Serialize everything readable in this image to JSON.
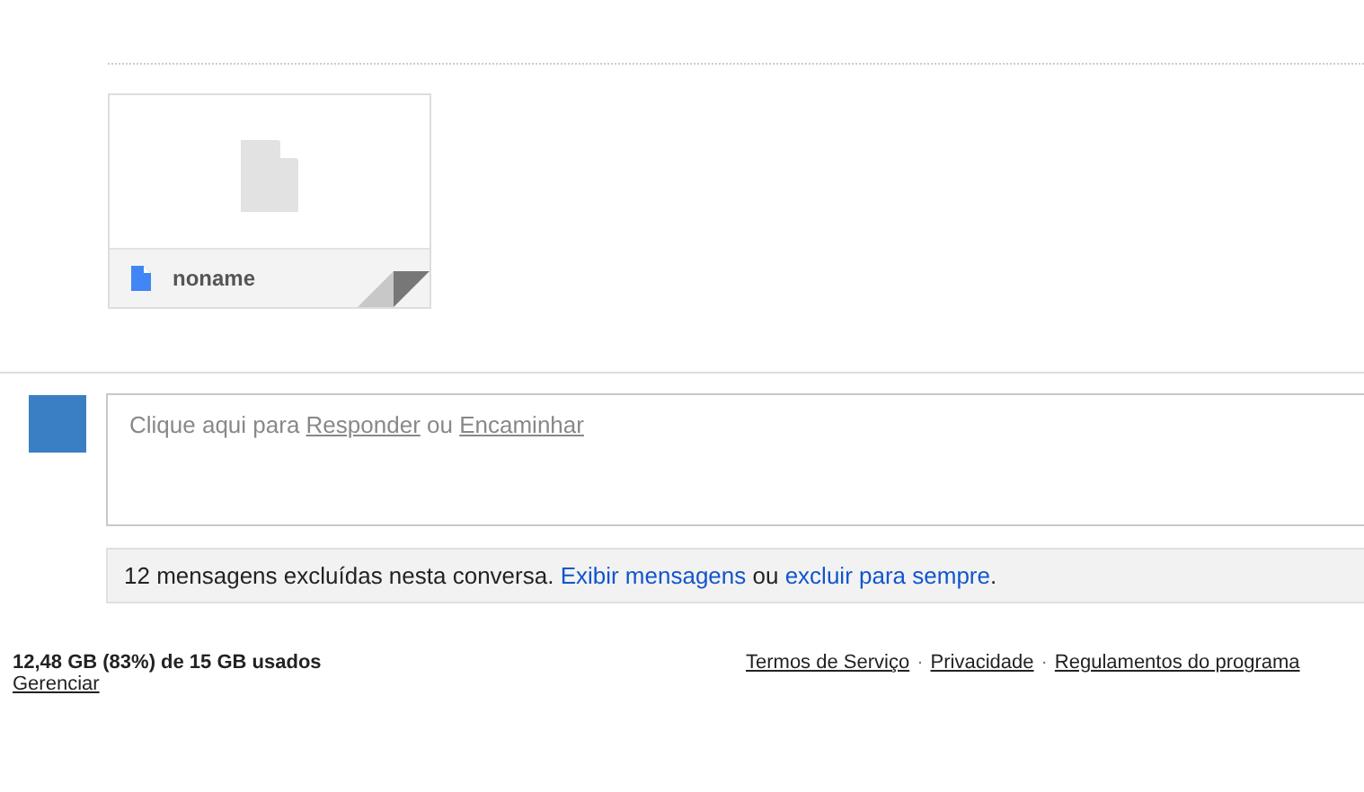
{
  "attachment": {
    "filename": "noname"
  },
  "reply_box": {
    "prefix": "Clique aqui para",
    "reply_link": "Responder",
    "joiner": "ou",
    "forward_link": "Encaminhar"
  },
  "deleted_notice": {
    "text": "12 mensagens excluídas nesta conversa.",
    "show_link": "Exibir mensagens",
    "joiner": "ou",
    "delete_link": "excluir para sempre",
    "suffix": "."
  },
  "footer": {
    "storage": "12,48 GB (83%) de 15 GB usados",
    "manage_link": "Gerenciar",
    "separator": "·",
    "links": [
      "Termos de Serviço",
      "Privacidade",
      "Regulamentos do programa"
    ]
  }
}
